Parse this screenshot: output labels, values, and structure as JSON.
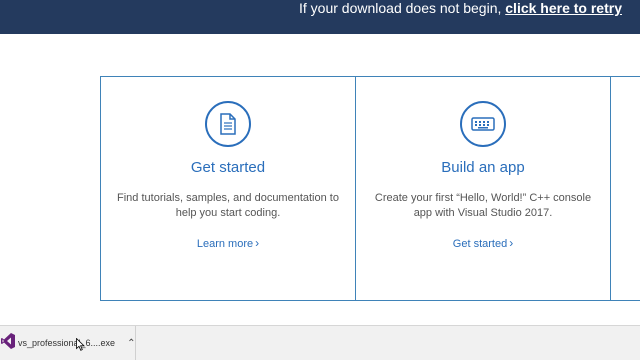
{
  "banner": {
    "text": "If your download does not begin, ",
    "link": "click here to retry"
  },
  "cards": [
    {
      "icon": "document-icon",
      "title": "Get started",
      "description": "Find tutorials, samples, and documentation to help you start coding.",
      "link": "Learn more"
    },
    {
      "icon": "keyboard-icon",
      "title": "Build an app",
      "description": "Create your first “Hello, World!” C++ console app with Visual Studio 2017.",
      "link": "Get started"
    }
  ],
  "download_bar": {
    "file_name": "vs_professional_6....exe",
    "icon": "visual-studio-icon",
    "menu_icon": "chevron-up-icon"
  },
  "colors": {
    "banner": "#243a5e",
    "accent": "#2a6ebb",
    "card_border": "#3f83b8"
  }
}
